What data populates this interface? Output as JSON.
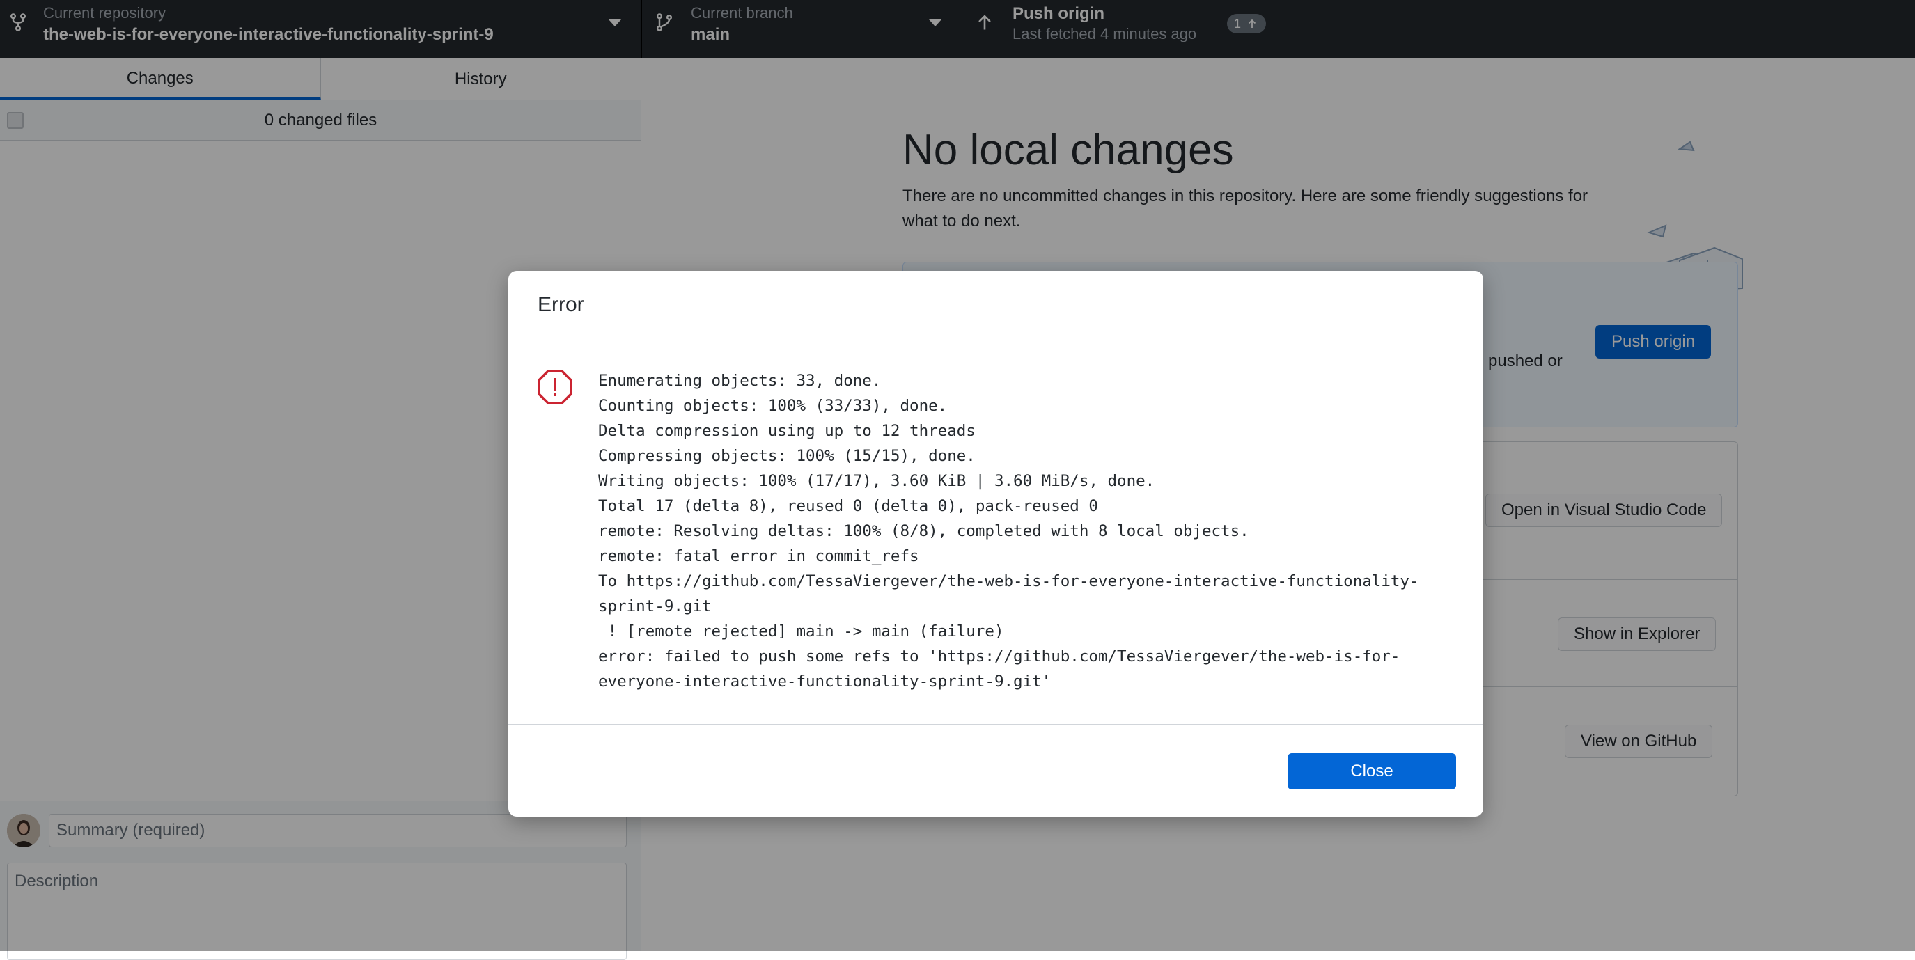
{
  "toolbar": {
    "repository": {
      "label": "Current repository",
      "value": "the-web-is-for-everyone-interactive-functionality-sprint-9"
    },
    "branch": {
      "label": "Current branch",
      "value": "main"
    },
    "push": {
      "label": "Push origin",
      "sublabel": "Last fetched 4 minutes ago",
      "badge_count": "1"
    }
  },
  "sidebar": {
    "tabs": [
      {
        "label": "Changes",
        "active": true
      },
      {
        "label": "History",
        "active": false
      }
    ],
    "changed_files": "0 changed files",
    "commit": {
      "summary_placeholder": "Summary (required)",
      "description_placeholder": "Description"
    }
  },
  "main": {
    "title": "No local changes",
    "description": "There are no uncommitted changes in this repository. Here are some friendly suggestions for what to do next.",
    "push_fragment": "pushed or",
    "push_button": "Push origin",
    "open_editor_button": "Open in Visual Studio Code",
    "show_explorer_button": "Show in Explorer",
    "view_github_button": "View on GitHub"
  },
  "dialog": {
    "title": "Error",
    "output_lines": [
      "Enumerating objects: 33, done.",
      "Counting objects: 100% (33/33), done.",
      "Delta compression using up to 12 threads",
      "Compressing objects: 100% (15/15), done.",
      "Writing objects: 100% (17/17), 3.60 KiB | 3.60 MiB/s, done.",
      "Total 17 (delta 8), reused 0 (delta 0), pack-reused 0",
      "remote: Resolving deltas: 100% (8/8), completed with 8 local objects.",
      "remote: fatal error in commit_refs",
      "To https://github.com/TessaViergever/the-web-is-for-everyone-interactive-functionality-sprint-9.git",
      " ! [remote rejected] main -> main (failure)",
      "error: failed to push some refs to 'https://github.com/TessaViergever/the-web-is-for-everyone-interactive-functionality-sprint-9.git'"
    ],
    "close_button": "Close"
  },
  "colors": {
    "toolbar_bg": "#24292e",
    "accent_blue": "#0366d6",
    "error_red": "#cb2431"
  }
}
